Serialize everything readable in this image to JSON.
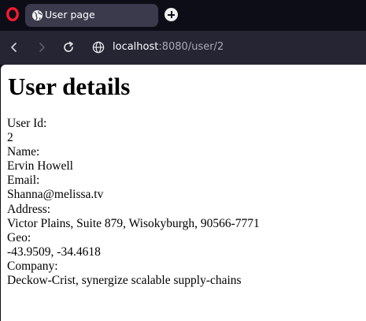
{
  "browser": {
    "tab_title": "User page",
    "url_host": "localhost",
    "url_path": ":8080/user/2"
  },
  "page": {
    "heading": "User details",
    "fields": [
      {
        "label": "User Id:",
        "value": "2"
      },
      {
        "label": "Name:",
        "value": "Ervin Howell"
      },
      {
        "label": "Email:",
        "value": "Shanna@melissa.tv"
      },
      {
        "label": "Address:",
        "value": "Victor Plains, Suite 879, Wisokyburgh, 90566-7771"
      },
      {
        "label": "Geo:",
        "value": "-43.9509, -34.4618"
      },
      {
        "label": "Company:",
        "value": "Deckow-Crist, synergize scalable supply-chains"
      }
    ]
  },
  "colors": {
    "brand_red": "#ff1b2d",
    "tab_bg": "#3a3a4c",
    "toolbar_bg": "#252534",
    "chrome_bg": "#0d0d18"
  },
  "icons": [
    "opera-logo-icon",
    "globe-icon",
    "plus-icon",
    "back-icon",
    "forward-icon",
    "reload-icon"
  ]
}
